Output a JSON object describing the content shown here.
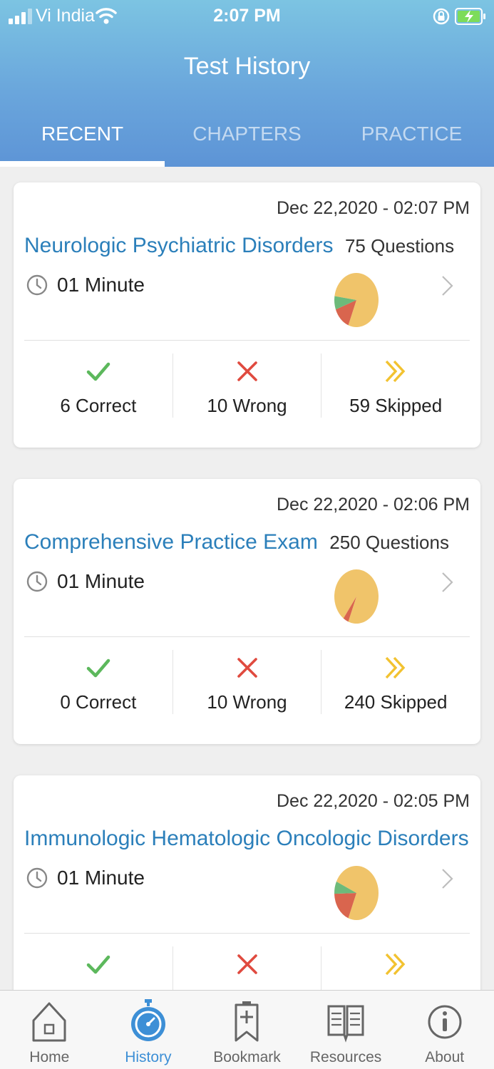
{
  "status_bar": {
    "carrier": "Vi India",
    "time": "2:07 PM"
  },
  "header": {
    "title": "Test History",
    "tabs": [
      {
        "label": "RECENT",
        "active": true
      },
      {
        "label": "CHAPTERS",
        "active": false
      },
      {
        "label": "PRACTICE",
        "active": false
      }
    ]
  },
  "colors": {
    "header_top": "#7cc4e2",
    "header_bottom": "#5d94d6",
    "title_blue": "#2b7fba",
    "correct_green": "#5cb85c",
    "wrong_red": "#e04a3f",
    "skipped_yellow": "#f2c230",
    "pie_skipped": "#f0c46a",
    "pie_wrong": "#d9654e",
    "pie_correct": "#6dba7a",
    "nav_active": "#3d8fd6"
  },
  "tests": [
    {
      "date": "Dec 22,2020 - 02:07 PM",
      "title": "Neurologic Psychiatric Disorders",
      "questions": "75 Questions",
      "duration": "01 Minute",
      "correct": "6 Correct",
      "wrong": "10 Wrong",
      "skipped": "59 Skipped",
      "pie": {
        "correct": 6,
        "wrong": 10,
        "skipped": 59
      }
    },
    {
      "date": "Dec 22,2020 - 02:06 PM",
      "title": "Comprehensive Practice Exam",
      "questions": "250 Questions",
      "duration": "01 Minute",
      "correct": "0 Correct",
      "wrong": "10 Wrong",
      "skipped": "240 Skipped",
      "pie": {
        "correct": 0,
        "wrong": 10,
        "skipped": 240
      }
    },
    {
      "date": "Dec 22,2020 - 02:05 PM",
      "title": "Immunologic Hematologic Oncologic Disorders",
      "questions": "...",
      "duration": "01 Minute",
      "correct": "",
      "wrong": "",
      "skipped": "",
      "pie": {
        "correct": 4,
        "wrong": 10,
        "skipped": 40
      }
    }
  ],
  "bottom_nav": [
    {
      "label": "Home",
      "icon": "home-icon",
      "active": false
    },
    {
      "label": "History",
      "icon": "stopwatch-icon",
      "active": true
    },
    {
      "label": "Bookmark",
      "icon": "bookmark-icon",
      "active": false
    },
    {
      "label": "Resources",
      "icon": "book-icon",
      "active": false
    },
    {
      "label": "About",
      "icon": "info-icon",
      "active": false
    }
  ]
}
